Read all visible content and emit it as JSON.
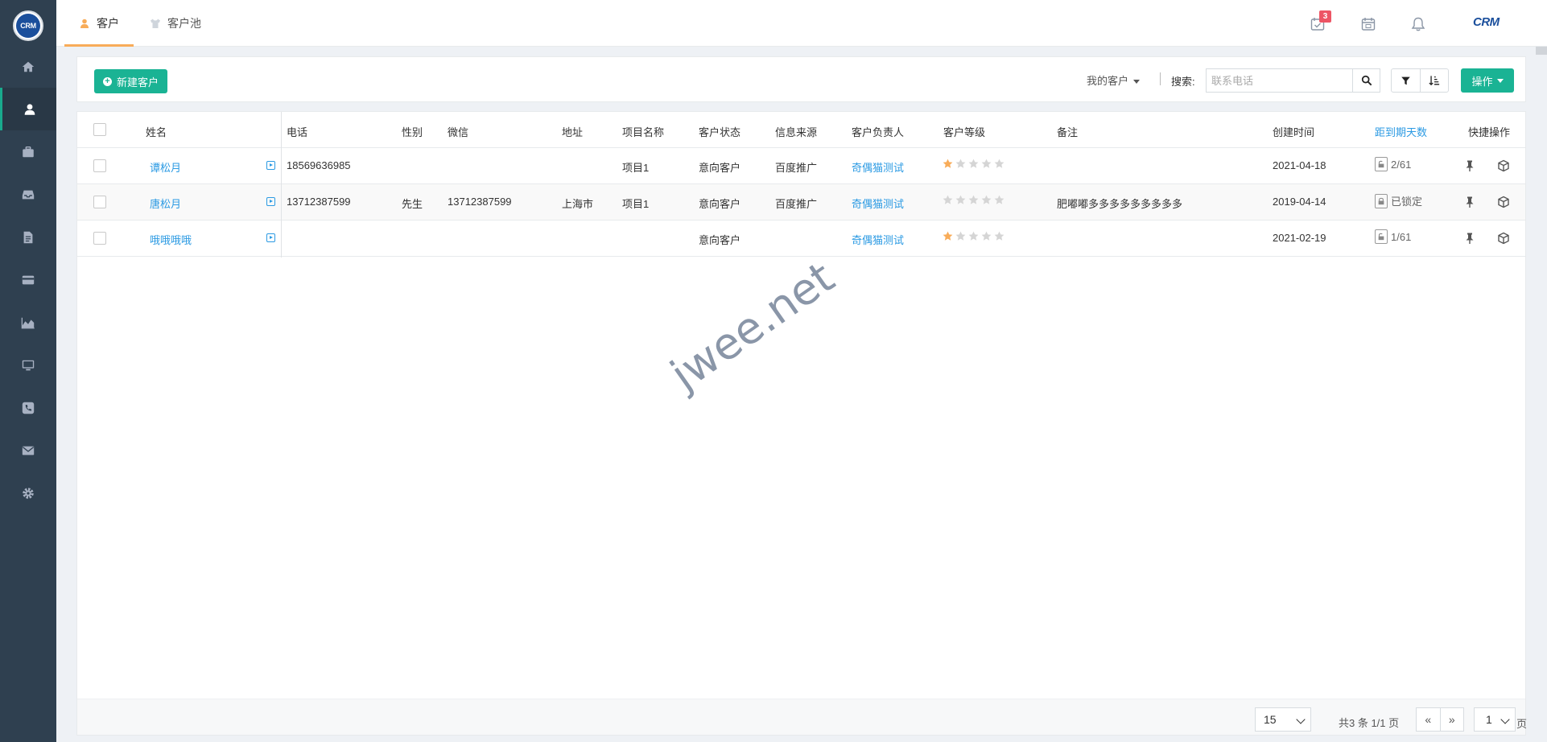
{
  "sidebar": {
    "logo_text": "CRM",
    "items": [
      {
        "icon": "home-icon"
      },
      {
        "icon": "user-icon",
        "active": true
      },
      {
        "icon": "briefcase-icon"
      },
      {
        "icon": "inbox-icon"
      },
      {
        "icon": "file-icon"
      },
      {
        "icon": "credit-card-icon"
      },
      {
        "icon": "area-chart-icon"
      },
      {
        "icon": "desktop-icon"
      },
      {
        "icon": "phone-icon"
      },
      {
        "icon": "envelope-icon"
      },
      {
        "icon": "gear-icon"
      }
    ]
  },
  "topbar": {
    "tabs": [
      {
        "label": "客户",
        "active": true
      },
      {
        "label": "客户池"
      }
    ],
    "task_badge": "3",
    "brand": "CRM"
  },
  "toolbar": {
    "new_button": "新建客户",
    "scope_dropdown": "我的客户",
    "search_label": "搜索:",
    "search_placeholder": "联系电话",
    "search_value": "",
    "ops_button": "操作"
  },
  "table": {
    "headers": {
      "name": "姓名",
      "phone": "电话",
      "gender": "性别",
      "wechat": "微信",
      "address": "地址",
      "project": "项目名称",
      "status": "客户状态",
      "source": "信息来源",
      "owner": "客户负责人",
      "level": "客户等级",
      "remark": "备注",
      "created": "创建时间",
      "days_left": "距到期天数",
      "quick": "快捷操作"
    },
    "rows": [
      {
        "name": "谭松月",
        "phone": "18569636985",
        "gender": "",
        "wechat": "",
        "address": "",
        "project": "项目1",
        "status": "意向客户",
        "source": "百度推广",
        "owner": "奇偶猫测试",
        "stars": 1,
        "remark": "",
        "created": "2021-04-18",
        "days_left": "2/61"
      },
      {
        "name": "唐松月",
        "phone": "13712387599",
        "gender": "先生",
        "wechat": "13712387599",
        "address": "上海市",
        "project": "项目1",
        "status": "意向客户",
        "source": "百度推广",
        "owner": "奇偶猫测试",
        "stars": 0,
        "remark": "肥嘟嘟多多多多多多多多多",
        "created": "2019-04-14",
        "days_left": "已锁定"
      },
      {
        "name": "哦哦哦哦",
        "phone": "",
        "gender": "",
        "wechat": "",
        "address": "",
        "project": "",
        "status": "意向客户",
        "source": "",
        "owner": "奇偶猫测试",
        "stars": 1,
        "remark": "",
        "created": "2021-02-19",
        "days_left": "1/61"
      }
    ]
  },
  "pagination": {
    "page_size": "15",
    "info": "共3 条 1/1 页",
    "prev": "«",
    "next": "»",
    "current_page": "1",
    "suffix": "页"
  },
  "colors": {
    "sidebar_bg": "#2f4050",
    "accent": "#1ab394",
    "link": "#2b9ae3",
    "star_on": "#f8ac59",
    "star_off": "#d5d5d5",
    "tab_underline": "#f8ac59"
  },
  "watermark": "jwee.net"
}
